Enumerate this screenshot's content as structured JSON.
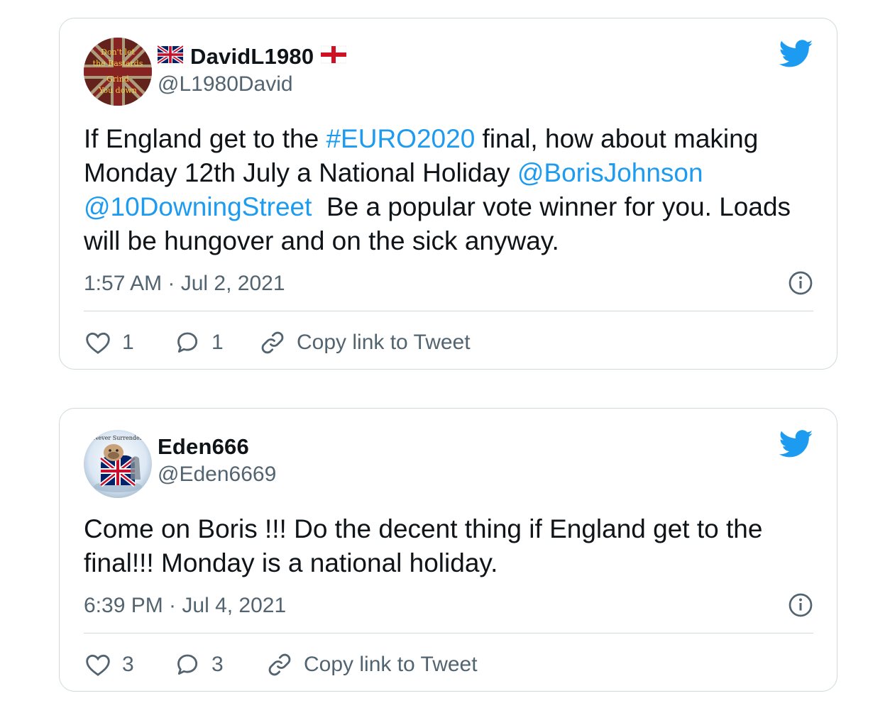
{
  "colors": {
    "accent": "#1d9bf0",
    "muted": "#536471",
    "border": "#cfd9de",
    "text": "#0f1419"
  },
  "tweets": [
    {
      "display_name": "DavidL1980",
      "name_prefix_icon": "uk-flag-icon",
      "name_suffix_icon": "england-flag-icon",
      "handle": "@L1980David",
      "avatar_text": {
        "line1": "Don't let",
        "line2": "the Bastards",
        "line3": "Grind",
        "line4": "You down"
      },
      "body": {
        "p1": "If England get to the ",
        "hashtag": "#EURO2020",
        "p2": " final, how about making Monday 12th July a National Holiday ",
        "mention1": "@BorisJohnson",
        "p3": " ",
        "mention2": "@10DowningStreet",
        "p4": "  Be a popular vote winner for you. Loads will be hungover and on the sick anyway."
      },
      "timestamp": "1:57 AM · Jul 2, 2021",
      "likes": "1",
      "replies": "1",
      "copy_link_label": "Copy link to Tweet"
    },
    {
      "display_name": "Eden666",
      "handle": "@Eden6669",
      "avatar_text": {
        "line1": "Never Surrender"
      },
      "body": {
        "p1": "Come on Boris !!! Do the decent thing if England get to the final!!! Monday is a national holiday."
      },
      "timestamp": "6:39 PM · Jul 4, 2021",
      "likes": "3",
      "replies": "3",
      "copy_link_label": "Copy link to Tweet"
    }
  ]
}
